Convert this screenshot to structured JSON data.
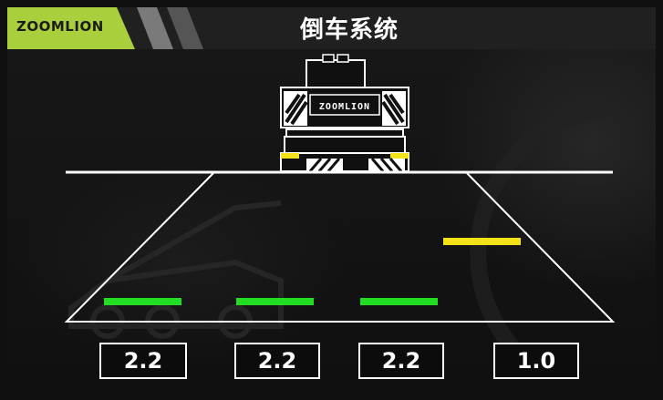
{
  "header": {
    "brand": "ZOOMLION",
    "title": "倒车系统"
  },
  "vehicle": {
    "label": "ZOOMLION"
  },
  "sensors": [
    {
      "id": "left-outer",
      "value": "2.2",
      "status_color": "#22dd22"
    },
    {
      "id": "left-inner",
      "value": "2.2",
      "status_color": "#22dd22"
    },
    {
      "id": "right-inner",
      "value": "2.2",
      "status_color": "#22dd22"
    },
    {
      "id": "right-outer",
      "value": "1.0",
      "status_color": "#f2e21a"
    }
  ],
  "colors": {
    "brand_accent": "#a9cf3c",
    "safe": "#22dd22",
    "warning": "#f2e21a",
    "lines": "#ffffff"
  }
}
